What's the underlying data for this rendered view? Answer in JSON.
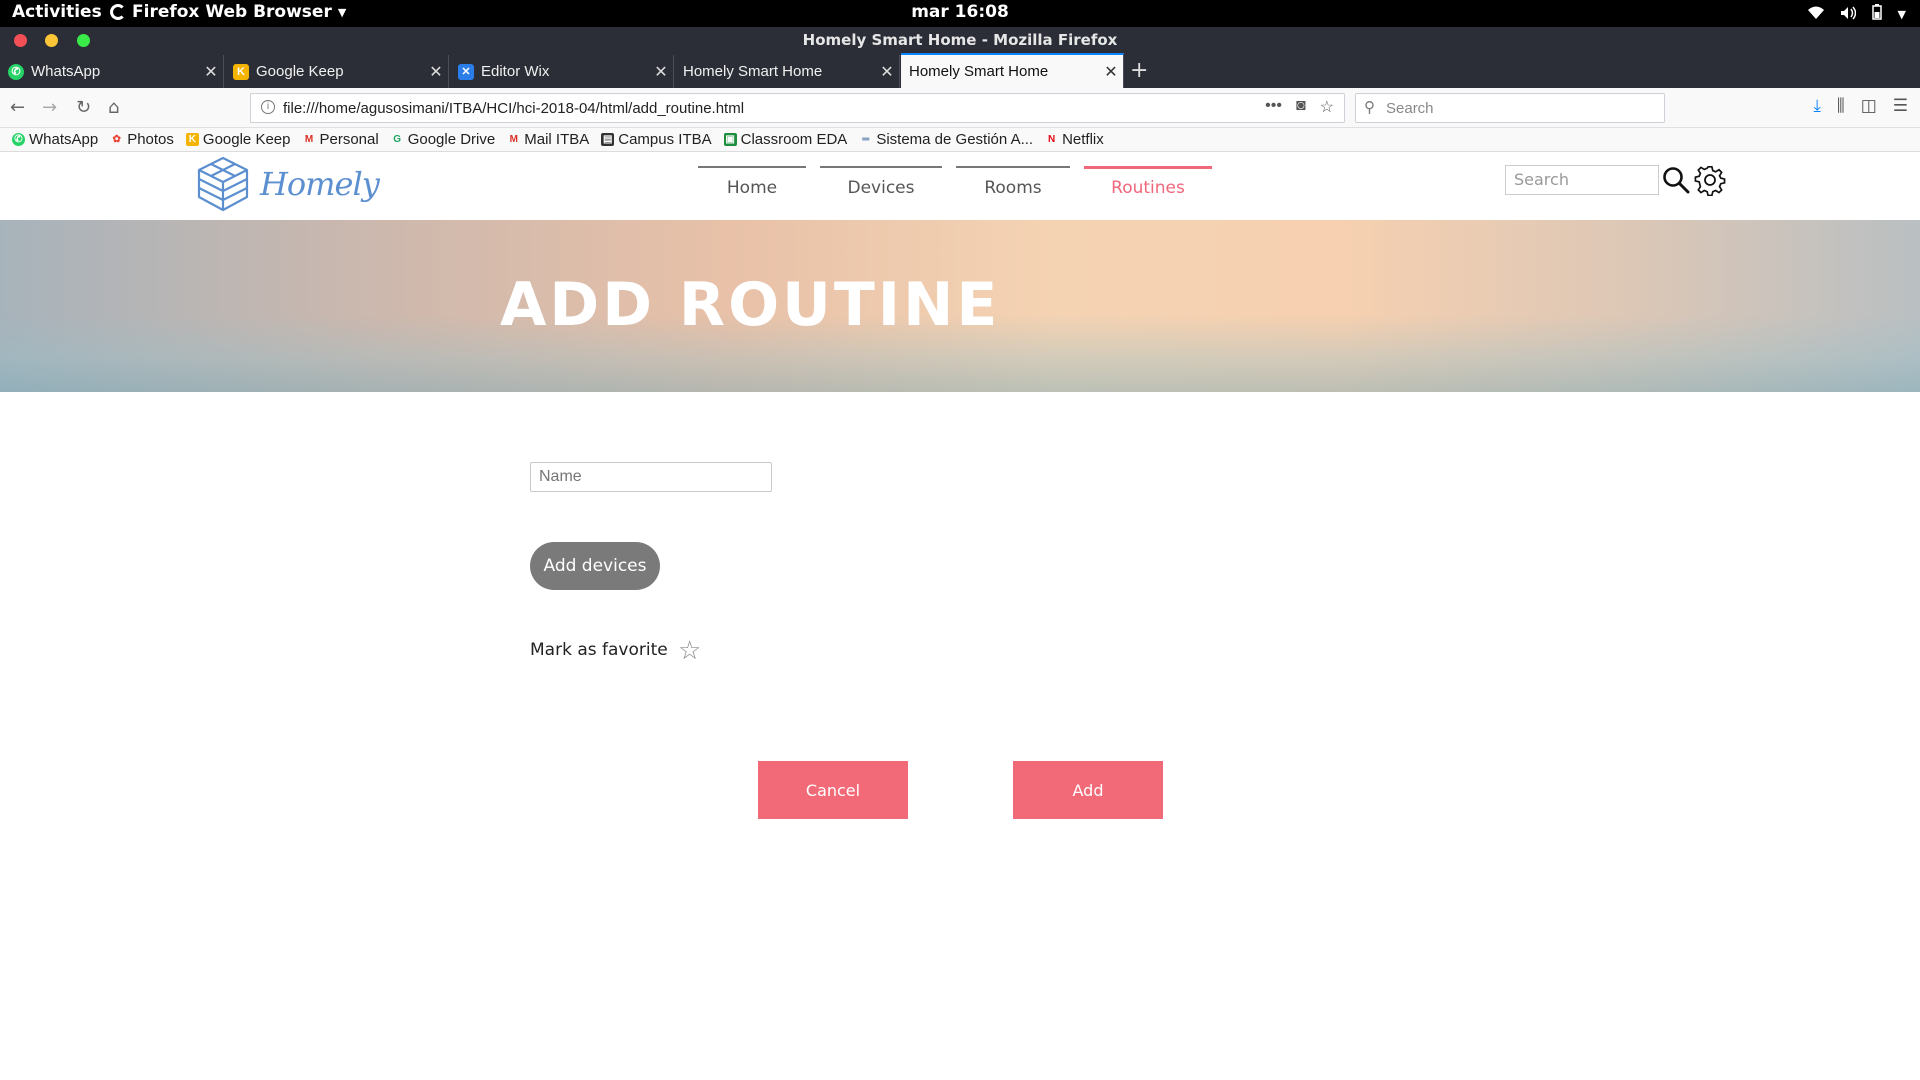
{
  "system": {
    "activities": "Activities",
    "app_menu": "Firefox Web Browser",
    "clock": "mar 16:08"
  },
  "window": {
    "title": "Homely Smart Home - Mozilla Firefox"
  },
  "tabs": [
    {
      "title": "WhatsApp",
      "icon": "whatsapp-icon",
      "color": "#25d366"
    },
    {
      "title": "Google Keep",
      "icon": "keep-icon",
      "color": "#f4b400"
    },
    {
      "title": "Editor Wix",
      "icon": "wix-icon",
      "color": "#2b7de9"
    },
    {
      "title": "Homely Smart Home",
      "icon": "none",
      "color": ""
    },
    {
      "title": "Homely Smart Home",
      "icon": "none",
      "color": "",
      "active": true
    }
  ],
  "toolbar": {
    "url": "file:///home/agusosimani/ITBA/HCI/hci-2018-04/html/add_routine.html",
    "search_placeholder": "Search"
  },
  "bookmarks": [
    {
      "label": "WhatsApp",
      "icon": "whatsapp-icon",
      "color": "#25d366",
      "glyph": "●"
    },
    {
      "label": "Photos",
      "icon": "photos-icon",
      "color": "#ea4335",
      "glyph": "✿"
    },
    {
      "label": "Google Keep",
      "icon": "keep-icon",
      "color": "#f4b400",
      "glyph": "K"
    },
    {
      "label": "Personal",
      "icon": "gmail-icon",
      "color": "#d93025",
      "glyph": "M"
    },
    {
      "label": "Google Drive",
      "icon": "drive-icon",
      "color": "#1fa463",
      "glyph": "G"
    },
    {
      "label": "Mail ITBA",
      "icon": "gmail-icon",
      "color": "#d93025",
      "glyph": "M"
    },
    {
      "label": "Campus ITBA",
      "icon": "campus-icon",
      "color": "#333333",
      "glyph": "▤"
    },
    {
      "label": "Classroom EDA",
      "icon": "classroom-icon",
      "color": "#1e8e3e",
      "glyph": "▣"
    },
    {
      "label": "Sistema de Gestión A...",
      "icon": "sga-icon",
      "color": "#1a4b8c",
      "glyph": "═"
    },
    {
      "label": "Netflix",
      "icon": "netflix-icon",
      "color": "#e50914",
      "glyph": "N"
    }
  ],
  "site": {
    "logo": "Homely",
    "nav": [
      {
        "label": "Home",
        "width": 88
      },
      {
        "label": "Devices",
        "width": 100
      },
      {
        "label": "Rooms",
        "width": 93
      },
      {
        "label": "Routines",
        "width": 105,
        "active": true
      }
    ],
    "search_placeholder": "Search",
    "accent_color": "#f0677c"
  },
  "hero": {
    "title": "ADD ROUTINE"
  },
  "form": {
    "name_placeholder": "Name",
    "add_devices_label": "Add devices",
    "favorite_label": "Mark as favorite",
    "cancel_label": "Cancel",
    "add_label": "Add"
  }
}
